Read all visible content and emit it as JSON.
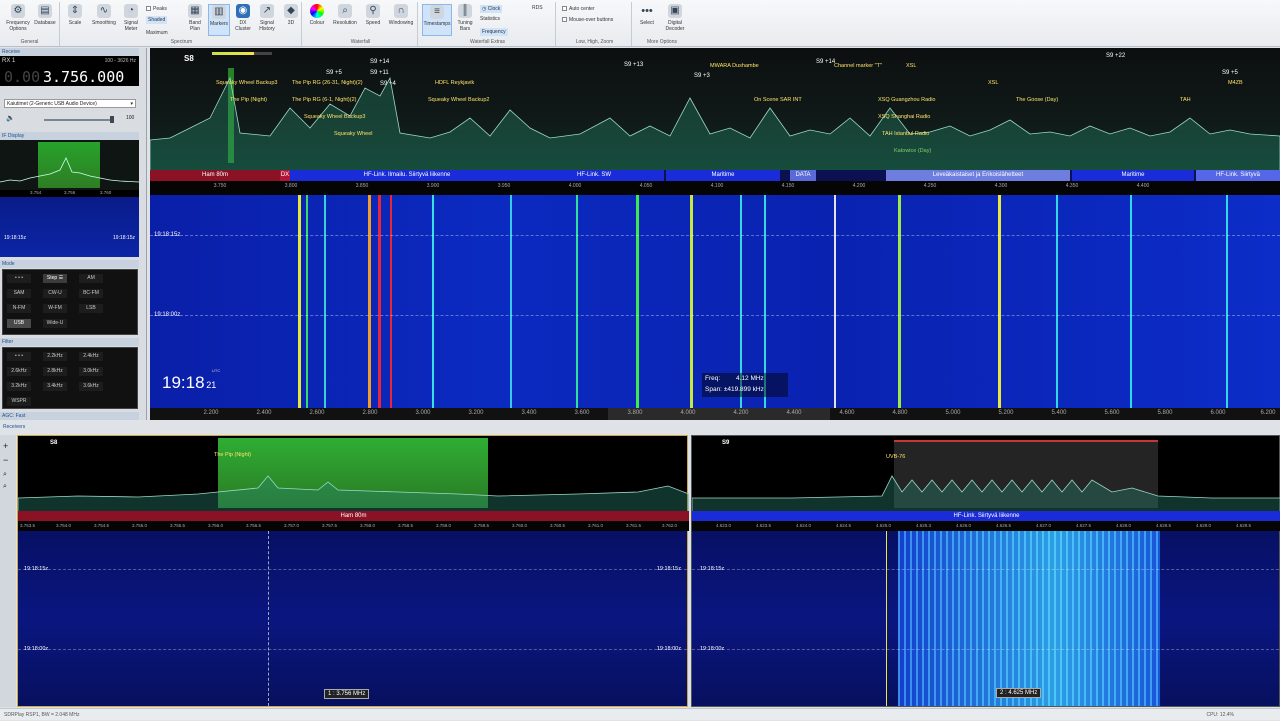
{
  "ribbon": {
    "general": {
      "label": "General",
      "freq_options": "Frequency Options",
      "database": "Database"
    },
    "spectrum": {
      "label": "Spectrum",
      "scale": "Scale",
      "smoothing": "Smoothing",
      "signal_meter": "Signal Meter",
      "peaks": "Peaks",
      "shaded": "Shaded",
      "maximum": "Maximum",
      "band_plan": "Band Plan",
      "markers": "Markers",
      "dx_cluster": "DX Cluster",
      "signal_history": "Signal History",
      "three_d": "3D"
    },
    "waterfall": {
      "label": "Waterfall",
      "colour": "Colour",
      "resolution": "Resolution",
      "speed": "Speed",
      "windowing": "Windowing"
    },
    "waterfall_extras": {
      "label": "Waterfall Extras",
      "timestamps": "Timestamps",
      "tuning_bars": "Tuning Bars",
      "clock": "Clock",
      "statistics": "Statistics",
      "frequency": "Frequency",
      "rds": "RDS"
    },
    "lhz": {
      "label": "Low, High, Zoom",
      "auto_center": "Auto center",
      "mouseover": "Mouse-over buttons"
    },
    "more": {
      "label": "More Options",
      "select": "Select",
      "digital_decoder": "Digital Decoder"
    }
  },
  "left": {
    "receive_title": "Receive",
    "rx": "RX 1",
    "range": "100 - 3626 Hz",
    "freq_dim": "0.00",
    "freq_main": "3.756.000",
    "device": "Kaiutimet (2-Generic USB Audio Device)",
    "vol": "100",
    "if_title": "IF Display",
    "if_scale": [
      "3.754",
      "3.756",
      "3.760"
    ],
    "if_time1": "19:18:15z",
    "if_time2": "19:18:15z",
    "mode_title": "Mode",
    "modes": [
      "• • •",
      "Step ☰",
      "AM",
      "SAM",
      "CW-U",
      "BC-FM",
      "N-FM",
      "W-FM",
      "LSB",
      "USB",
      "Wide-U"
    ],
    "filter_title": "Filter",
    "filters": [
      "• • •",
      "2.2kHz",
      "2.4kHz",
      "2.6kHz",
      "2.8kHz",
      "3.0kHz",
      "3.2kHz",
      "3.4kHz",
      "3.6kHz",
      "WSPR"
    ],
    "agc": "AGC: Fast"
  },
  "main": {
    "smeter": "S8",
    "spec_labels": [
      {
        "t": "Squeaky Wheel Backup3",
        "c": "y"
      },
      {
        "t": "The Pip (Night)",
        "c": "y"
      },
      {
        "t": "The Pip RG (26-31, Night)(2)",
        "c": "y"
      },
      {
        "t": "The Pip RG (6-1, Night)(2)",
        "c": "y"
      },
      {
        "t": "Squeaky Wheel Backup3",
        "c": "y"
      },
      {
        "t": "Squeaky Wheel",
        "c": "y"
      },
      {
        "t": "HDFL Reykjavik",
        "c": "y"
      },
      {
        "t": "Squeaky Wheel Backup2",
        "c": "y"
      },
      {
        "t": "MWARA Dushambe",
        "c": "y"
      },
      {
        "t": "On Scene SAR INT",
        "c": "y"
      },
      {
        "t": "Channel marker \"T\"",
        "c": "y"
      },
      {
        "t": "XSL",
        "c": "y"
      },
      {
        "t": "XSQ Guangzhou Radio",
        "c": "y"
      },
      {
        "t": "XSQ Shanghai Radio",
        "c": "y"
      },
      {
        "t": "TAH Istanbul Radio",
        "c": "y"
      },
      {
        "t": "XSL",
        "c": "y"
      },
      {
        "t": "The Goose (Day)",
        "c": "y"
      },
      {
        "t": "TAH",
        "c": "y"
      },
      {
        "t": "M4ZB",
        "c": "y"
      },
      {
        "t": "Katowice (Day)",
        "c": "g"
      }
    ],
    "s_labels": [
      "S9 +5",
      "S9 +14",
      "S9 +11",
      "S9 +4",
      "S9 +13",
      "S9 +3",
      "S9 +14",
      "S9 +22",
      "S9 +5"
    ],
    "bands": [
      "Ham 80m",
      "DX",
      "HF-Link. Ilmailu. Siirtyvä liikenne",
      "HF-Link. SW",
      "Maritime",
      "DATA",
      "Leveäkaistaiset ja Erikoislähetteet",
      "Maritime",
      "HF-Link. Siirtyvä"
    ],
    "scale_ticks": [
      "3.750",
      "3.800",
      "3.850",
      "3.900",
      "3.950",
      "4.000",
      "4.050",
      "4.100",
      "4.150",
      "4.200",
      "4.250",
      "4.300",
      "4.350",
      "4.400"
    ],
    "wf_time1": "19:18:15z",
    "wf_time2": "19:18:00z",
    "clock_hm": "19:18",
    "clock_s": "21",
    "clock_utc": "UTC",
    "freq_label": "Freq:",
    "freq_val": "4.12 MHz",
    "span_label": "Span:",
    "span_val": "±419.899 kHz",
    "axis_ticks": [
      "2.200",
      "2.400",
      "2.600",
      "2.800",
      "3.000",
      "3.200",
      "3.400",
      "3.600",
      "3.800",
      "4.000",
      "4.200",
      "4.400",
      "4.600",
      "4.800",
      "5.000",
      "5.200",
      "5.400",
      "5.600",
      "5.800",
      "6.000",
      "6.200"
    ]
  },
  "receivers": {
    "title": "Receivers",
    "rx1": {
      "smeter": "S8",
      "label": "The Pip (Night)",
      "band": "Ham 80m",
      "ticks": [
        "3.753.5",
        "3.754.0",
        "3.754.5",
        "3.755.0",
        "3.755.5",
        "3.756.0",
        "3.756.5",
        "3.757.0",
        "3.757.5",
        "3.758.0",
        "3.758.5",
        "3.759.0",
        "3.759.5",
        "3.760.0",
        "3.760.5",
        "3.761.0",
        "3.761.5",
        "3.762.0"
      ],
      "time1": "19:18:15z",
      "time2": "19:18:00z",
      "tag": "1 : 3.756 MHz"
    },
    "rx2": {
      "smeter": "S9",
      "label": "UVB-76",
      "band": "HF-Link. Siirtyvä liikenne",
      "ticks": [
        "4.623.0",
        "4.623.5",
        "4.624.0",
        "4.624.5",
        "4.625.0",
        "4.625.3",
        "4.626.0",
        "4.626.5",
        "4.627.0",
        "4.627.5",
        "4.628.0",
        "4.628.5",
        "4.629.0",
        "4.629.5"
      ],
      "time1": "19:18:15z",
      "time2": "19:18:00z",
      "tag": "2 : 4.625 MHz"
    }
  },
  "status": {
    "left": "SDRPlay RSP1, BW = 2.048 MHz",
    "cpu": "CPU: 12.4%"
  }
}
